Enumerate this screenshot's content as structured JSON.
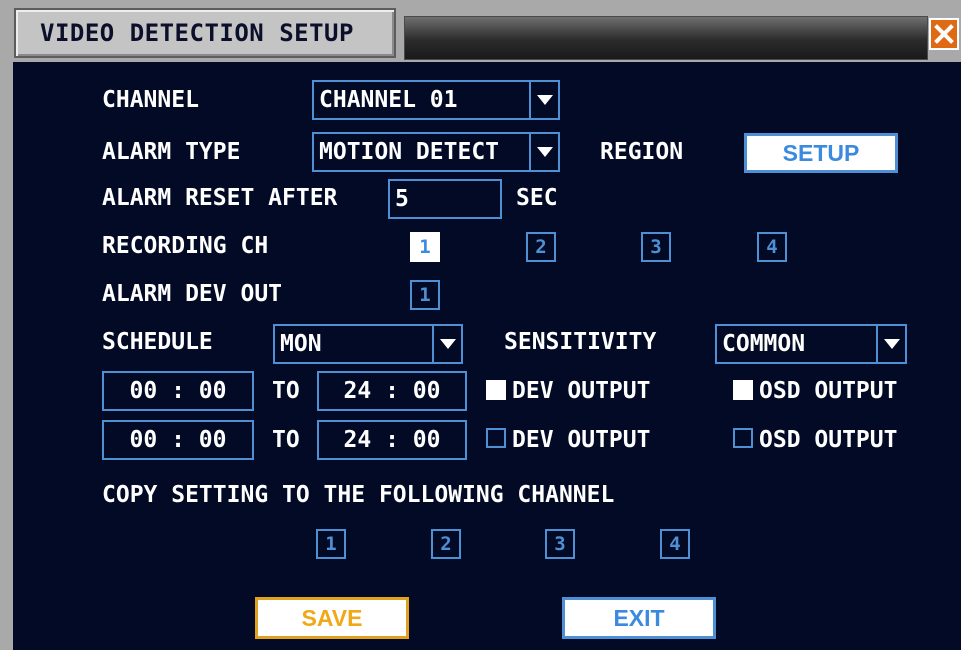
{
  "window": {
    "title": "VIDEO DETECTION SETUP",
    "close_icon": "close-x-icon"
  },
  "form": {
    "channel_label": "CHANNEL",
    "channel_value": "CHANNEL 01",
    "alarm_type_label": "ALARM TYPE",
    "alarm_type_value": "MOTION DETECT",
    "region_label": "REGION",
    "region_setup_button": "SETUP",
    "alarm_reset_label": "ALARM RESET AFTER",
    "alarm_reset_value": "5",
    "alarm_reset_unit": "SEC",
    "recording_ch_label": "RECORDING CH",
    "recording_channels": [
      {
        "num": "1",
        "checked": true
      },
      {
        "num": "2",
        "checked": false
      },
      {
        "num": "3",
        "checked": false
      },
      {
        "num": "4",
        "checked": false
      }
    ],
    "alarm_dev_out_label": "ALARM DEV OUT",
    "alarm_dev_out": [
      {
        "num": "1",
        "checked": false
      }
    ],
    "schedule_label": "SCHEDULE",
    "schedule_value": "MON",
    "sensitivity_label": "SENSITIVITY",
    "sensitivity_value": "COMMON",
    "periods": [
      {
        "start": "00 : 00",
        "to": "TO",
        "end": "24 : 00",
        "dev_output_label": "DEV OUTPUT",
        "dev_output": true,
        "osd_output_label": "OSD OUTPUT",
        "osd_output": true
      },
      {
        "start": "00 : 00",
        "to": "TO",
        "end": "24 : 00",
        "dev_output_label": "DEV OUTPUT",
        "dev_output": false,
        "osd_output_label": "OSD OUTPUT",
        "osd_output": false
      }
    ],
    "copy_label": "COPY SETTING TO THE FOLLOWING CHANNEL",
    "copy_channels": [
      {
        "num": "1",
        "checked": false
      },
      {
        "num": "2",
        "checked": false
      },
      {
        "num": "3",
        "checked": false
      },
      {
        "num": "4",
        "checked": false
      }
    ],
    "save_button": "SAVE",
    "exit_button": "EXIT"
  },
  "colors": {
    "panel_bg": "#020a26",
    "accent_blue": "#4f8fd4",
    "save_orange": "#f0a818",
    "close_orange": "#e06a14",
    "title_grey": "#c4c4c4"
  }
}
